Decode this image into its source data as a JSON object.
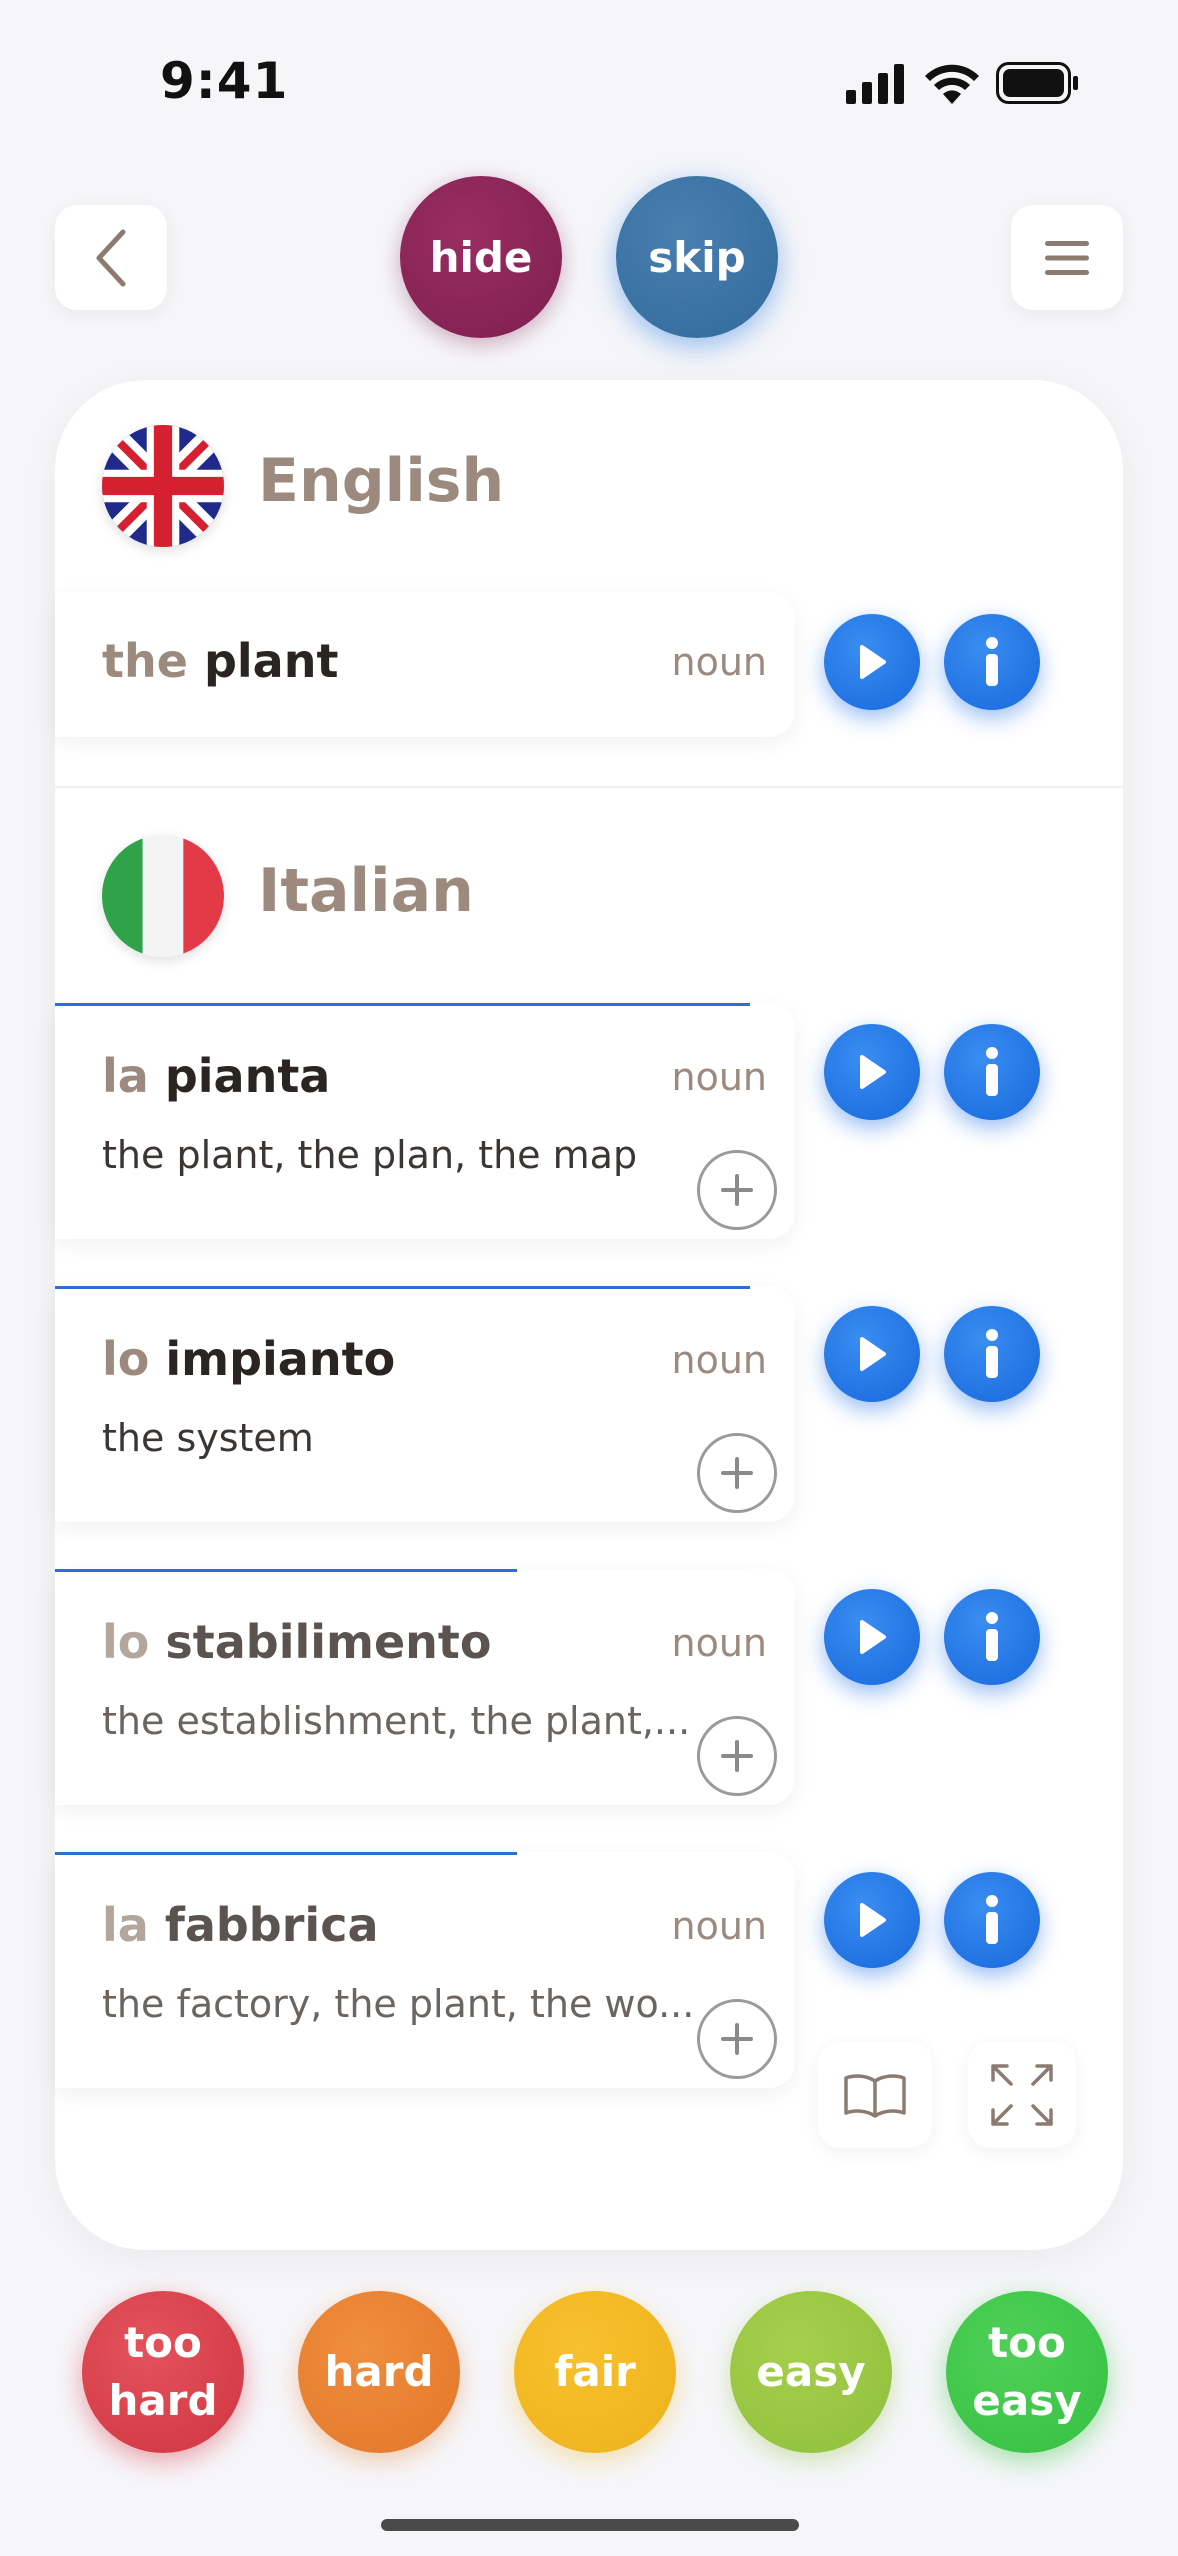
{
  "status_bar": {
    "time": "9:41"
  },
  "header": {
    "hide_label": "hide",
    "skip_label": "skip"
  },
  "source": {
    "language": "English",
    "entry": {
      "article": "the",
      "word": "plant",
      "pos": "noun"
    }
  },
  "target": {
    "language": "Italian",
    "entries": [
      {
        "article": "la",
        "word": "pianta",
        "pos": "noun",
        "translation": "the plant, the plan, the map",
        "progress": 0.65
      },
      {
        "article": "lo",
        "word": "impianto",
        "pos": "noun",
        "translation": "the system",
        "progress": 0.65
      },
      {
        "article": "lo",
        "word": "stabilimento",
        "pos": "noun",
        "translation": "the establishment, the plant,...",
        "progress": 0.43
      },
      {
        "article": "la",
        "word": "fabbrica",
        "pos": "noun",
        "translation": "the factory, the plant, the wo...",
        "progress": 0.43
      }
    ]
  },
  "rating": {
    "too_hard": "too hard",
    "hard": "hard",
    "fair": "fair",
    "easy": "easy",
    "too_easy": "too easy"
  },
  "colors": {
    "accent_blue": "#1f72e0",
    "hide": "#7e1f4f",
    "skip": "#2f6a9b",
    "too_hard": "#d63b46",
    "hard": "#e67e32",
    "fair": "#f2b922",
    "easy": "#98c442",
    "too_easy": "#3cc44a"
  },
  "icons": {
    "back": "chevron-left-icon",
    "menu": "hamburger-menu-icon",
    "play": "play-icon",
    "info": "info-icon",
    "add": "plus-icon",
    "book": "book-icon",
    "expand": "expand-icon"
  }
}
